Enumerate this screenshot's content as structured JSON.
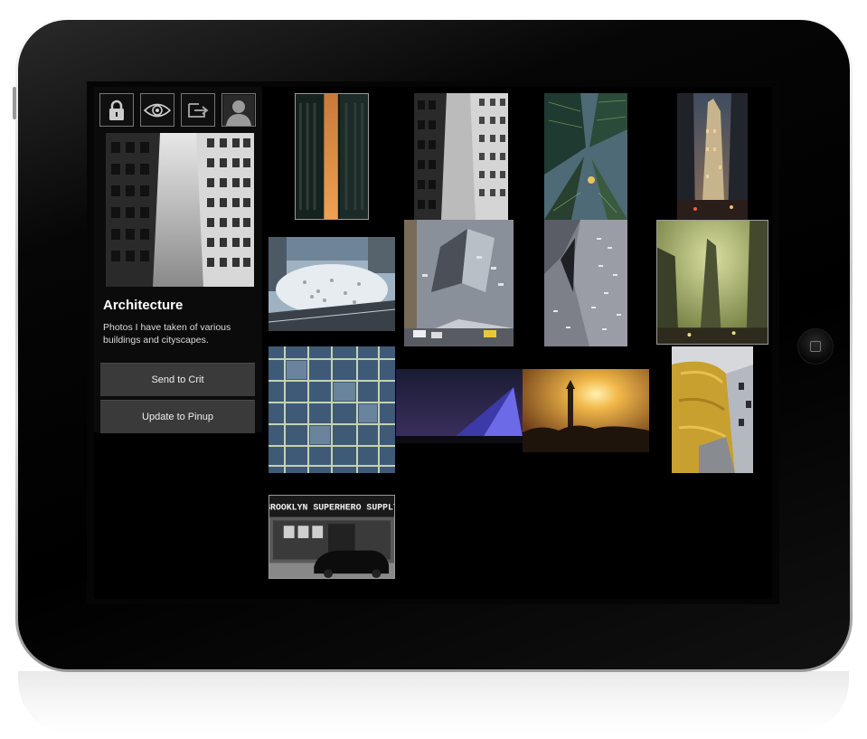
{
  "device": {
    "name": "iPad"
  },
  "toolbar": {
    "icons": [
      "lock-icon",
      "eye-icon",
      "export-icon",
      "profile-icon"
    ]
  },
  "album": {
    "title": "Architecture",
    "description": "Photos I have taken of various buildings and cityscapes."
  },
  "actions": {
    "send_label": "Send to Crit",
    "update_label": "Update to Pinup"
  },
  "photos": [
    {
      "subject": "sunset-between-skyscrapers"
    },
    {
      "subject": "looking-up-between-buildings"
    },
    {
      "subject": "glass-towers-looking-up"
    },
    {
      "subject": "skyscraper-at-dusk"
    },
    {
      "subject": "snowy-park-aerial"
    },
    {
      "subject": "cooper-union-building"
    },
    {
      "subject": "perforated-facade"
    },
    {
      "subject": "flatiron-building"
    },
    {
      "subject": "glass-grid-facade"
    },
    {
      "subject": "pyramid-at-night"
    },
    {
      "subject": "minaret-sunset"
    },
    {
      "subject": "gehry-steel-curves"
    },
    {
      "subject": "brooklyn-superhero-supply"
    }
  ],
  "signage": {
    "storefront": "BROOKLYN SUPERHERO SUPPLY"
  },
  "colors": {
    "screen": "#000000",
    "button": "#3a3a3a",
    "frame": "#c9c9c9"
  }
}
